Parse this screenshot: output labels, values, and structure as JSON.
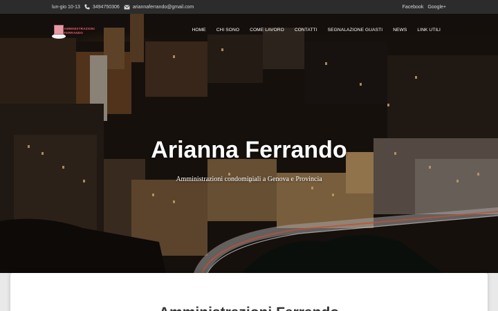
{
  "topbar": {
    "hours": "lun-gio 10-13",
    "phone": "3494750306",
    "email": "ariannaferrando@gmail.com",
    "social": [
      "Facebook",
      "Google+"
    ]
  },
  "logo": {
    "line1": "AMMINISTRAZIONI",
    "line2": "FERRANDO"
  },
  "nav": [
    "HOME",
    "CHI SONO",
    "COME LAVORO",
    "CONTATTI",
    "SEGNALAZIONE GUASTI",
    "NEWS",
    "LINK UTILI"
  ],
  "hero": {
    "title": "Arianna Ferrando",
    "subtitle": "Amministrazioni condominiali a Genova e Provincia"
  },
  "section": {
    "heading": "Amministrazioni Ferrando"
  }
}
